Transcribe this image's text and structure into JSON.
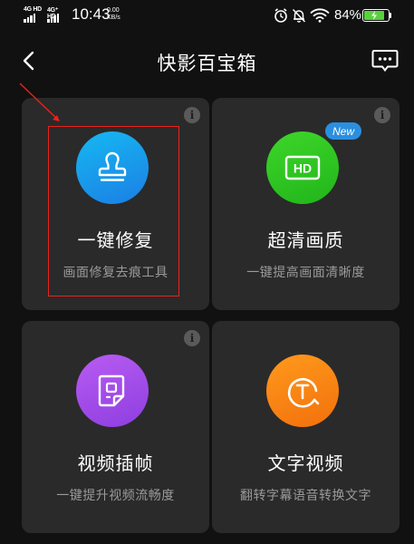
{
  "status_bar": {
    "sim1_label": "4G HD",
    "sim2_label": "4G⁺ HD",
    "time": "10:43",
    "net_speed_value": "0.00",
    "net_speed_unit": "KB/s",
    "battery_percent": "84%",
    "battery_level": 0.84,
    "icons": [
      "alarm-icon",
      "mute-bell-icon",
      "wifi-icon",
      "battery-icon"
    ]
  },
  "header": {
    "title": "快影百宝箱",
    "back_icon": "chevron-left-icon",
    "feedback_icon": "message-dots-icon"
  },
  "cards": [
    {
      "title": "一键修复",
      "subtitle": "画面修复去痕工具",
      "icon": "stamp-icon",
      "color": "#1b8fe6",
      "badge": ""
    },
    {
      "title": "超清画质",
      "subtitle": "一键提高画面清晰度",
      "icon": "hd-icon",
      "color": "#2ec31f",
      "badge": "New"
    },
    {
      "title": "视频插帧",
      "subtitle": "一键提升视频流畅度",
      "icon": "frame-doc-icon",
      "color": "#a84ce8",
      "badge": ""
    },
    {
      "title": "文字视频",
      "subtitle": "翻转字幕语音转换文字",
      "icon": "text-circle-icon",
      "color": "#f57d0f",
      "badge": ""
    }
  ],
  "colors": {
    "background": "#111111",
    "card": "#2a2a2a",
    "annotation": "#e8231a",
    "badge": "#2b8fe0"
  }
}
